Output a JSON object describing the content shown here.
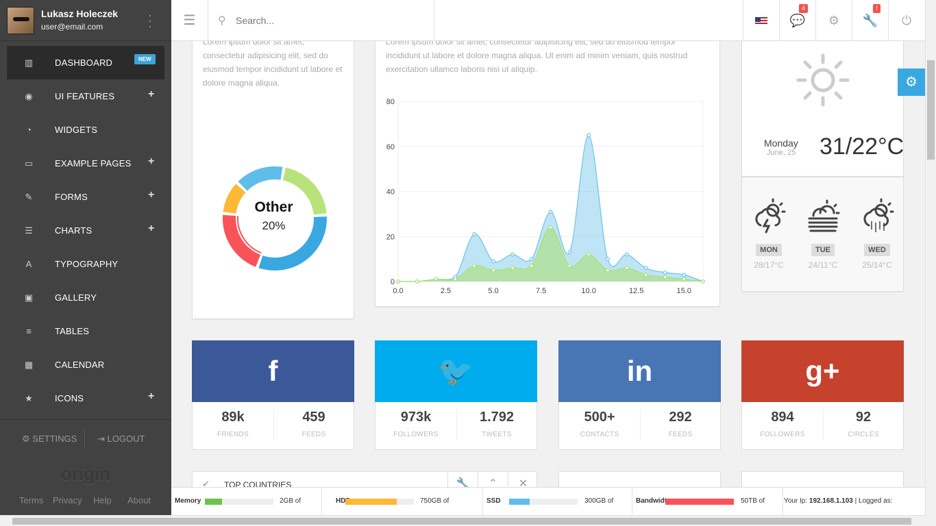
{
  "user": {
    "name": "Lukasz Holeczek",
    "email": "user@email.com"
  },
  "nav": [
    {
      "label": "DASHBOARD",
      "icon": "bar-chart-icon",
      "glyph": "▥",
      "badge": "NEW",
      "active": true
    },
    {
      "label": "UI FEATURES",
      "icon": "eye-icon",
      "glyph": "◉",
      "plus": "+"
    },
    {
      "label": "WIDGETS",
      "icon": "dashboard-icon",
      "glyph": "◔"
    },
    {
      "label": "EXAMPLE PAGES",
      "icon": "folder-icon",
      "glyph": "▭",
      "plus": "+"
    },
    {
      "label": "FORMS",
      "icon": "edit-icon",
      "glyph": "✎",
      "plus": "+"
    },
    {
      "label": "CHARTS",
      "icon": "list-alt-icon",
      "glyph": "☰",
      "plus": "+"
    },
    {
      "label": "TYPOGRAPHY",
      "icon": "font-icon",
      "glyph": "A"
    },
    {
      "label": "GALLERY",
      "icon": "picture-icon",
      "glyph": "▣"
    },
    {
      "label": "TABLES",
      "icon": "table-icon",
      "glyph": "≡"
    },
    {
      "label": "CALENDAR",
      "icon": "calendar-icon",
      "glyph": "▦"
    },
    {
      "label": "ICONS",
      "icon": "star-icon",
      "glyph": "★",
      "plus": "+"
    }
  ],
  "footer": {
    "settings": "SETTINGS",
    "logout": "LOGOUT",
    "logo": "origin",
    "links": [
      "Terms",
      "Privacy",
      "Help",
      "About"
    ]
  },
  "topbar": {
    "search_placeholder": "Search...",
    "messages_count": "4",
    "tools_badge": "!"
  },
  "donut": {
    "lorem": "Lorem ipsum dolor sit amet, consectetur adipisicing elit, sed do eiusmod tempor incididunt ut labore et dolore magna aliqua.",
    "label": "Other",
    "value": "20%",
    "segments": [
      {
        "value": 20,
        "color": "#b8e27a"
      },
      {
        "value": 30,
        "color": "#3aa8e0"
      },
      {
        "value": 20,
        "color": "#f95258"
      },
      {
        "value": 10,
        "color": "#fdb836"
      },
      {
        "value": 15,
        "color": "#5fbde9"
      }
    ]
  },
  "chart": {
    "lorem": "Lorem ipsum dolor sit amet, consectetur adipisicing elit, sed do eiusmod tempor incididunt ut labore et dolore magna aliqua. Ut enim ad minim veniam, quis nostrud exercitation ullamco laboris nisi ut aliquip."
  },
  "chart_data": {
    "type": "area",
    "xlim": [
      0,
      16
    ],
    "ylim": [
      0,
      80
    ],
    "xticks": [
      "0.0",
      "2.5",
      "5.0",
      "7.5",
      "10.0",
      "12.5",
      "15.0"
    ],
    "yticks": [
      "0",
      "20",
      "40",
      "60",
      "80"
    ],
    "x": [
      0,
      1,
      2,
      3,
      4,
      5,
      6,
      7,
      8,
      9,
      10,
      11,
      12,
      13,
      14,
      15,
      16
    ],
    "series": [
      {
        "color": "#6ec3ec",
        "values": [
          0,
          0,
          1,
          2,
          21,
          9,
          12,
          10,
          31,
          13,
          65,
          10,
          12,
          6,
          4,
          3,
          0
        ]
      },
      {
        "color": "#a8e06c",
        "values": [
          0,
          0,
          1,
          1,
          7,
          5,
          6,
          7,
          24,
          7,
          12,
          5,
          6,
          3,
          2,
          1,
          0
        ]
      }
    ]
  },
  "weather": {
    "day": "Monday",
    "date": "June, 25",
    "temp": "31/22°C",
    "forecast": [
      {
        "day": "MON",
        "temp": "28/17°C",
        "icon": "storm-icon"
      },
      {
        "day": "TUE",
        "temp": "24/11°C",
        "icon": "fog-icon"
      },
      {
        "day": "WED",
        "temp": "25/14°C",
        "icon": "rain-icon"
      }
    ]
  },
  "social": [
    {
      "name": "facebook",
      "glyph": "f",
      "color": "#3b5998",
      "stats": [
        {
          "num": "89k",
          "cap": "FRIENDS"
        },
        {
          "num": "459",
          "cap": "FEEDS"
        }
      ]
    },
    {
      "name": "twitter",
      "glyph": "🐦",
      "color": "#00aced",
      "stats": [
        {
          "num": "973k",
          "cap": "FOLLOWERS"
        },
        {
          "num": "1.792",
          "cap": "TWEETS"
        }
      ]
    },
    {
      "name": "linkedin",
      "glyph": "in",
      "color": "#4875b4",
      "stats": [
        {
          "num": "500+",
          "cap": "CONTACTS"
        },
        {
          "num": "292",
          "cap": "FEEDS"
        }
      ]
    },
    {
      "name": "google-plus",
      "glyph": "g+",
      "color": "#c6422d",
      "stats": [
        {
          "num": "894",
          "cap": "FOLLOWERS"
        },
        {
          "num": "92",
          "cap": "CIRCLES"
        }
      ]
    }
  ],
  "top_countries": {
    "title": "TOP COUNTRIES"
  },
  "status": [
    {
      "label": "Memory",
      "value": "2GB of",
      "fill": 0.25,
      "color": "#6dc24b"
    },
    {
      "label": "HDD",
      "value": "750GB of",
      "fill": 0.75,
      "color": "#fdb836"
    },
    {
      "label": "SSD",
      "value": "300GB of",
      "fill": 0.3,
      "color": "#5fbde9"
    },
    {
      "label": "Bandwidth",
      "value": "50TB of",
      "fill": 1.0,
      "color": "#f95258"
    }
  ],
  "ip": {
    "prefix": "Your Ip:",
    "ip": "192.168.1.103",
    "suffix": "| Logged as:"
  }
}
